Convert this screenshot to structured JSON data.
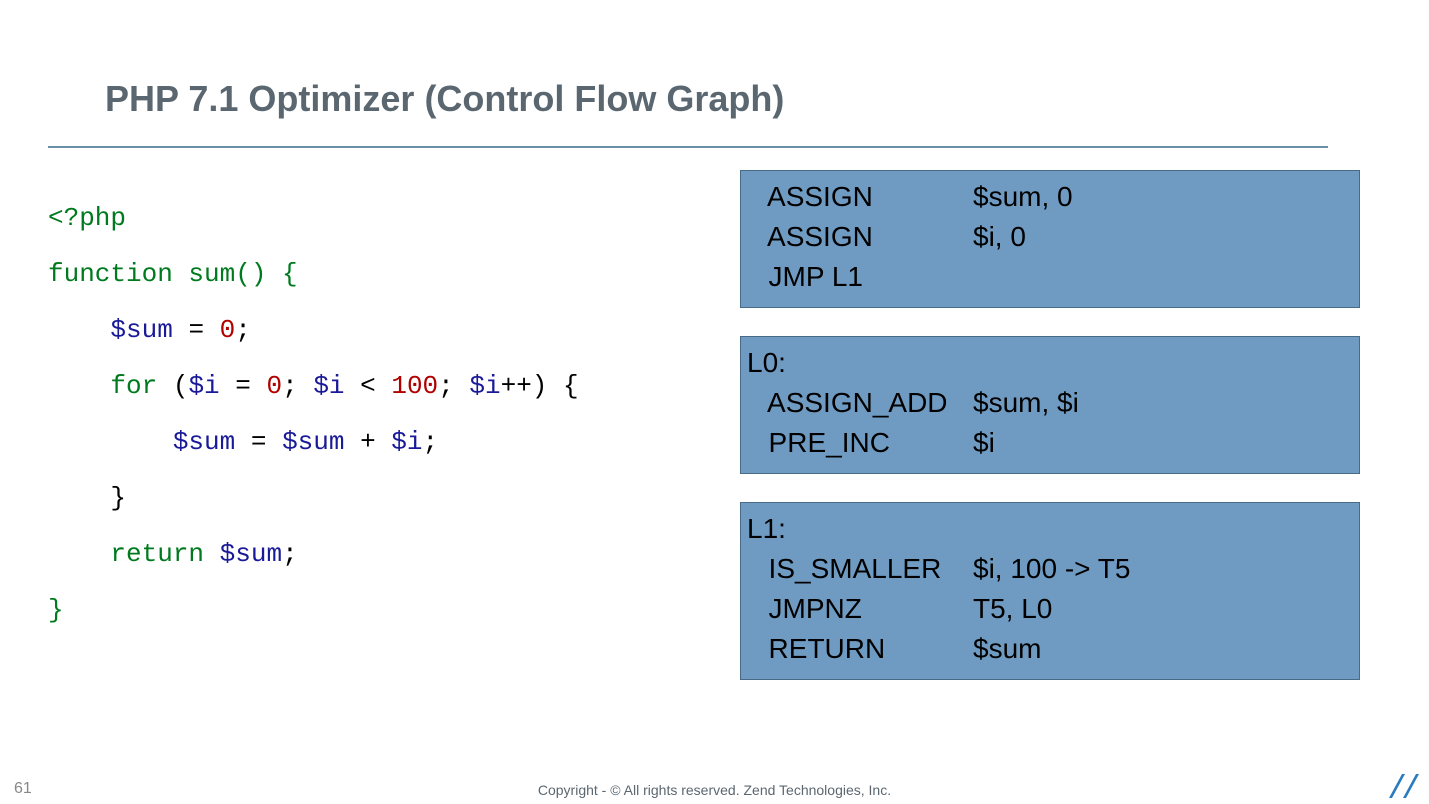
{
  "title": "PHP 7.1 Optimizer (Control Flow Graph)",
  "code": {
    "l1": {
      "t1": "<?php"
    },
    "l2": {
      "t1": "function",
      "t2": " sum() {"
    },
    "l3": {
      "t1": "$sum",
      "t2": " = ",
      "t3": "0",
      "t4": ";"
    },
    "l4": {
      "t1": "for",
      "t2": " (",
      "t3": "$i",
      "t4": " = ",
      "t5": "0",
      "t6": "; ",
      "t7": "$i",
      "t8": " < ",
      "t9": "100",
      "t10": "; ",
      "t11": "$i",
      "t12": "++) {"
    },
    "l5": {
      "t1": "$sum",
      "t2": " = ",
      "t3": "$sum",
      "t4": " + ",
      "t5": "$i",
      "t6": ";"
    },
    "l6": {
      "t1": "}"
    },
    "l7": {
      "t1": "return",
      "t2": " ",
      "t3": "$sum",
      "t4": ";"
    },
    "l8": {
      "t1": "}"
    }
  },
  "blocks": {
    "b0": {
      "rows": [
        {
          "op": "  ASSIGN",
          "arg": "$sum, 0"
        },
        {
          "op": "  ASSIGN",
          "arg": "$i, 0"
        },
        {
          "op": "  JMP L1",
          "arg": ""
        }
      ]
    },
    "b1": {
      "label": "L0:",
      "rows": [
        {
          "op": "  ASSIGN_ADD",
          "arg": "$sum, $i"
        },
        {
          "op": "  PRE_INC",
          "arg": "$i"
        }
      ]
    },
    "b2": {
      "label": "L1:",
      "rows": [
        {
          "op": "  IS_SMALLER",
          "arg": "$i, 100 -> T5"
        },
        {
          "op": "  JMPNZ",
          "arg": "T5, L0"
        },
        {
          "op": "  RETURN",
          "arg": "$sum"
        }
      ]
    }
  },
  "footer": "Copyright - © All rights reserved. Zend Technologies, Inc.",
  "page": "61"
}
